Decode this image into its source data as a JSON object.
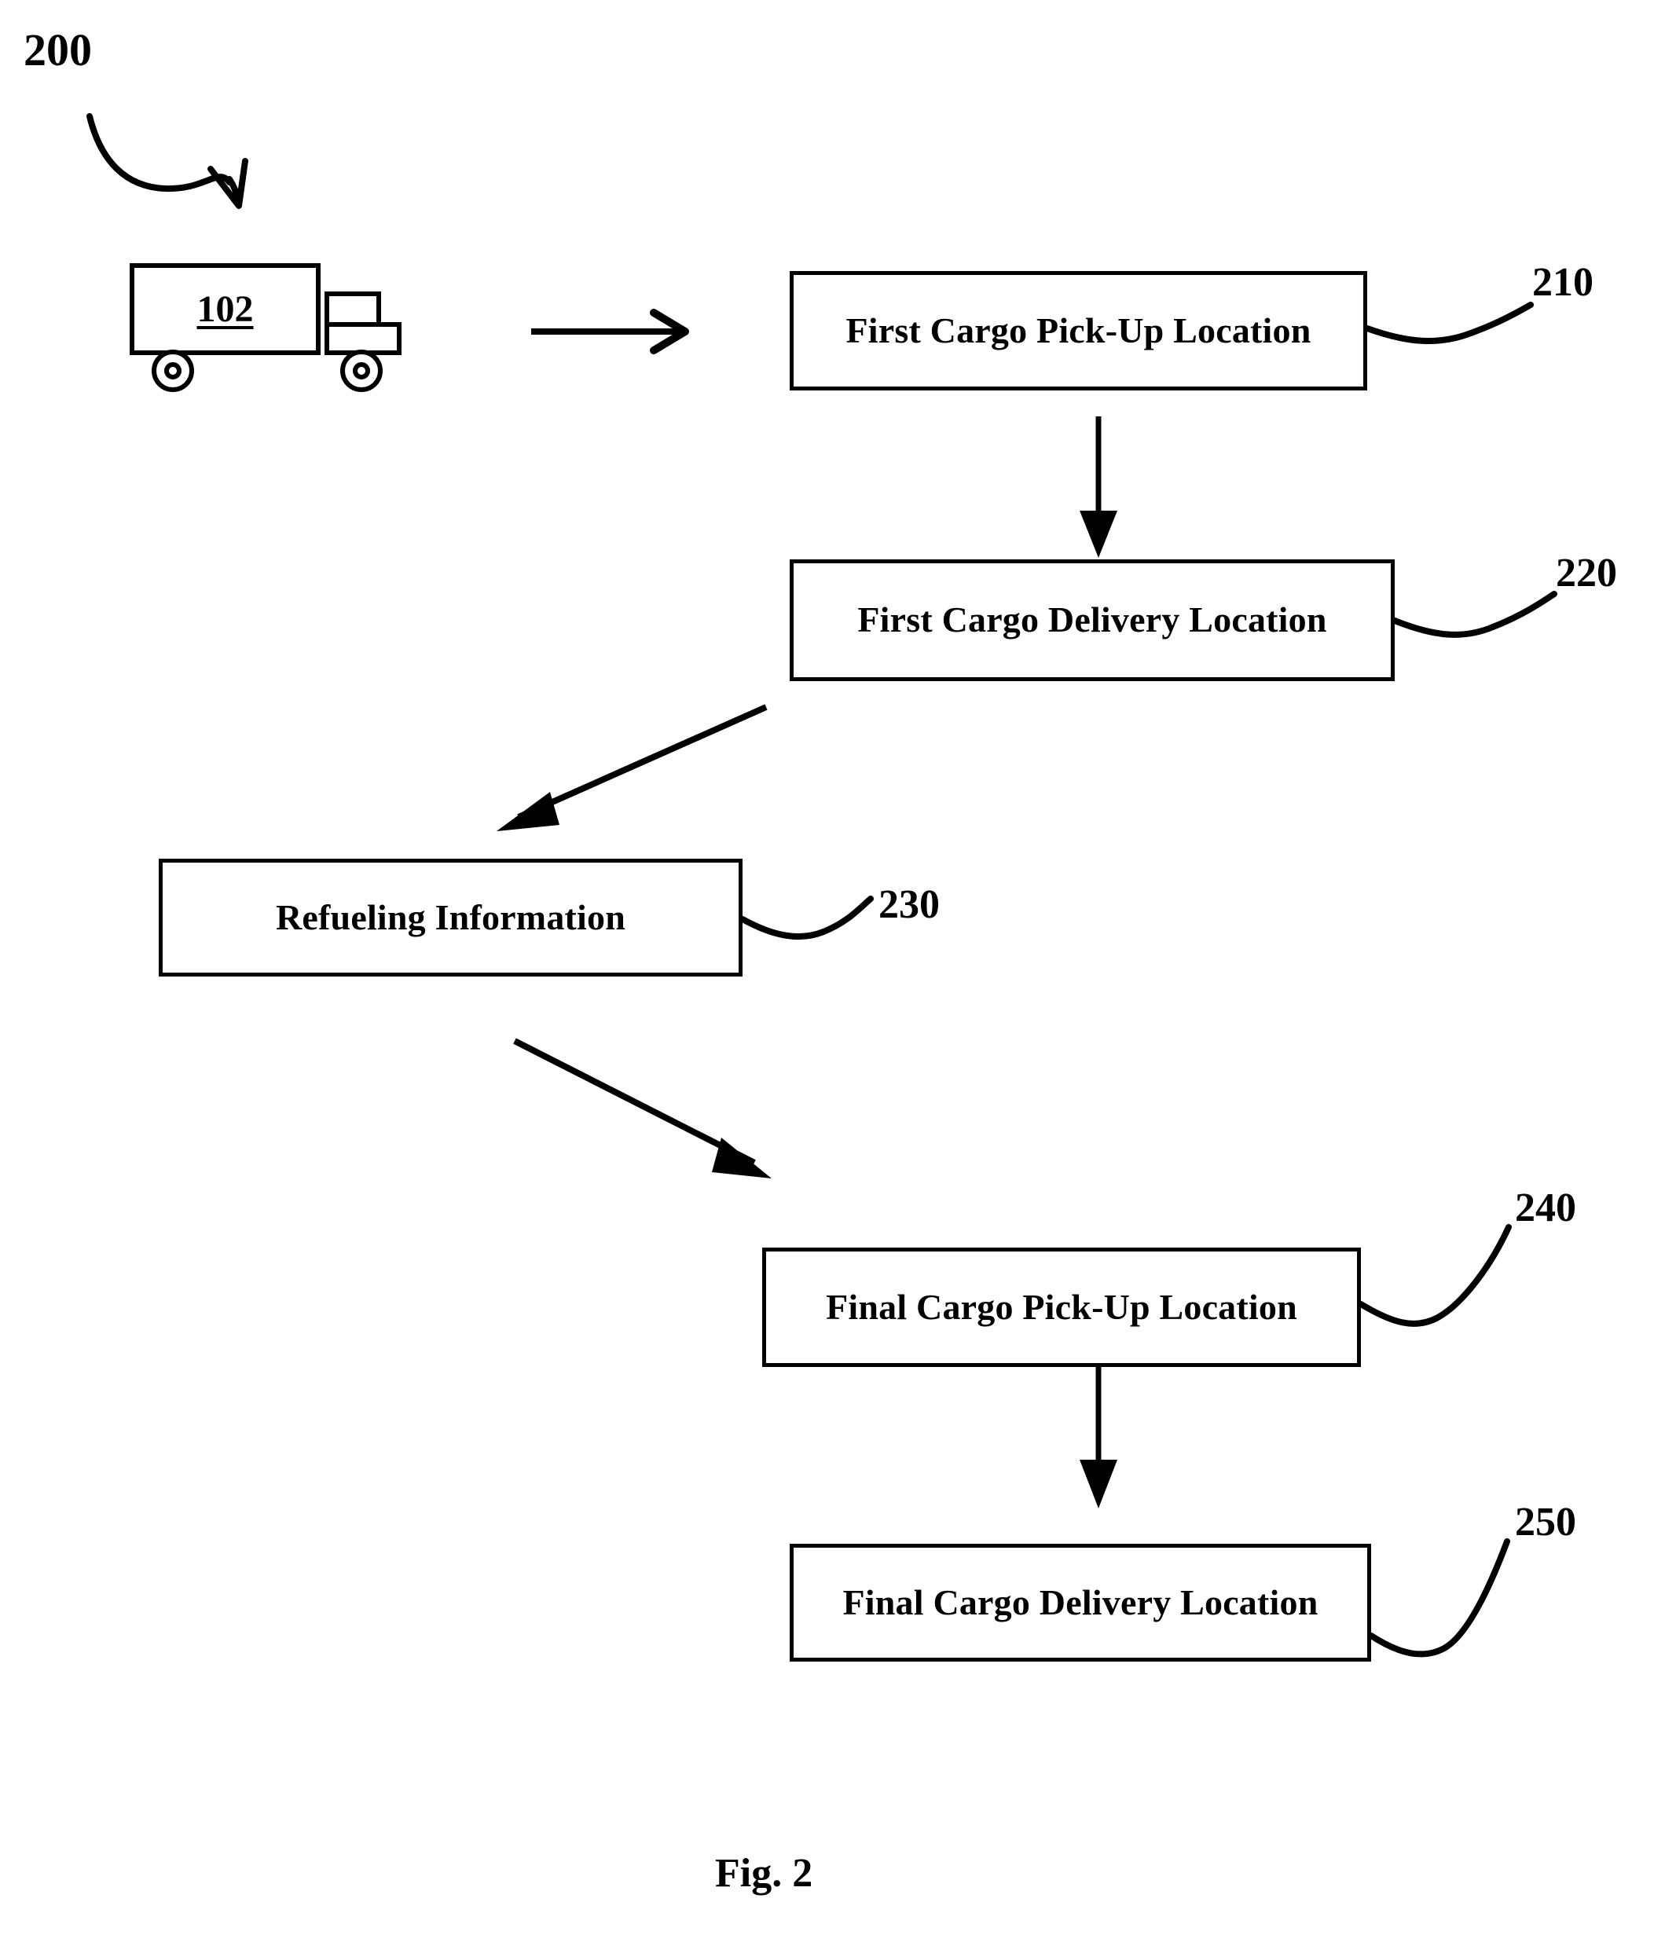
{
  "figure": {
    "number": "200",
    "caption": "Fig. 2"
  },
  "vehicle": {
    "name": "cargo-truck",
    "id_label": "102"
  },
  "nodes": [
    {
      "key": "first_pickup",
      "label": "First Cargo Pick-Up Location",
      "ref": "210"
    },
    {
      "key": "first_delivery",
      "label": "First Cargo Delivery Location",
      "ref": "220"
    },
    {
      "key": "refueling",
      "label": "Refueling Information",
      "ref": "230"
    },
    {
      "key": "final_pickup",
      "label": "Final Cargo Pick-Up Location",
      "ref": "240"
    },
    {
      "key": "final_delivery",
      "label": "Final Cargo Delivery Location",
      "ref": "250"
    }
  ],
  "colors": {
    "stroke": "#000000",
    "background": "#ffffff"
  }
}
